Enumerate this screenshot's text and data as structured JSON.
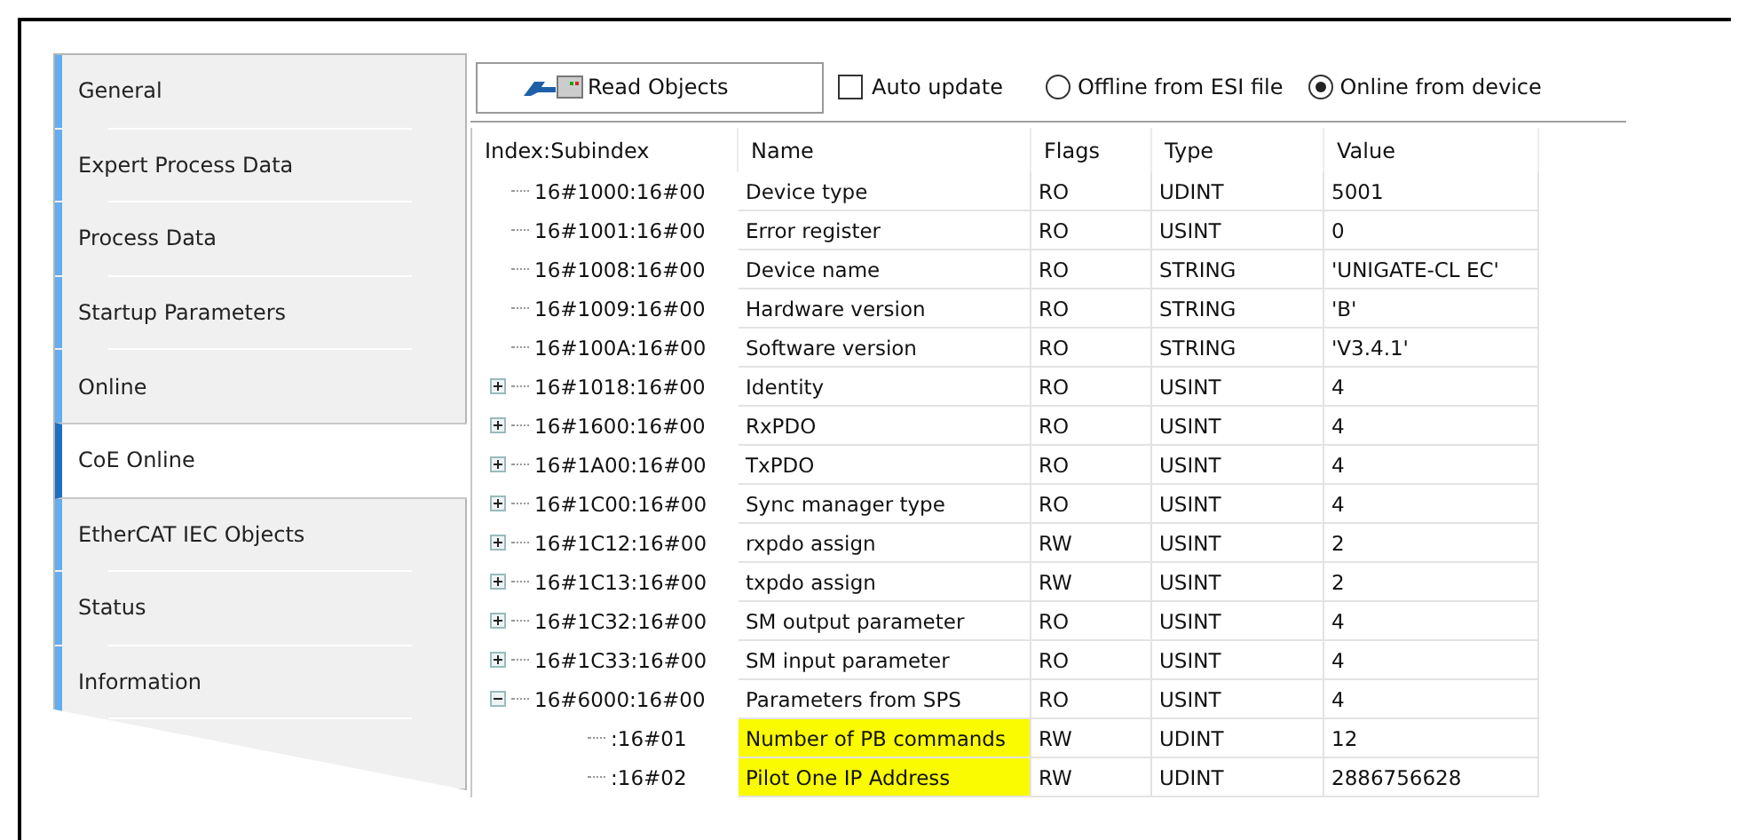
{
  "sidebar": {
    "tabs": [
      {
        "label": "General",
        "selected": false
      },
      {
        "label": "Expert Process Data",
        "selected": false
      },
      {
        "label": "Process Data",
        "selected": false
      },
      {
        "label": "Startup Parameters",
        "selected": false
      },
      {
        "label": "Online",
        "selected": false
      },
      {
        "label": "CoE Online",
        "selected": true
      },
      {
        "label": "EtherCAT IEC Objects",
        "selected": false
      },
      {
        "label": "Status",
        "selected": false
      },
      {
        "label": "Information",
        "selected": false
      }
    ]
  },
  "toolbar": {
    "read_button": "Read Objects",
    "auto_update": {
      "label": "Auto update",
      "checked": false
    },
    "source": [
      {
        "label": "Offline from ESI file",
        "selected": false
      },
      {
        "label": "Online from device",
        "selected": true
      }
    ]
  },
  "table": {
    "columns": [
      "Index:Subindex",
      "Name",
      "Flags",
      "Type",
      "Value"
    ],
    "rows": [
      {
        "index": "16#1000:16#00",
        "name": "Device type",
        "flags": "RO",
        "type": "UDINT",
        "value": "5001",
        "highlighted": false
      },
      {
        "index": "16#1001:16#00",
        "name": "Error register",
        "flags": "RO",
        "type": "USINT",
        "value": "0",
        "highlighted": false
      },
      {
        "index": "16#1008:16#00",
        "name": "Device name",
        "flags": "RO",
        "type": "STRING",
        "value": "'UNIGATE-CL EC'",
        "highlighted": false
      },
      {
        "index": "16#1009:16#00",
        "name": "Hardware version",
        "flags": "RO",
        "type": "STRING",
        "value": "'B'",
        "highlighted": false
      },
      {
        "index": "16#100A:16#00",
        "name": "Software version",
        "flags": "RO",
        "type": "STRING",
        "value": "'V3.4.1'",
        "highlighted": false
      },
      {
        "index": "16#1018:16#00",
        "name": "Identity",
        "flags": "RO",
        "type": "USINT",
        "value": "4",
        "highlighted": false,
        "expanded": false
      },
      {
        "index": "16#1600:16#00",
        "name": "RxPDO",
        "flags": "RO",
        "type": "USINT",
        "value": "4",
        "highlighted": false,
        "expanded": false
      },
      {
        "index": "16#1A00:16#00",
        "name": "TxPDO",
        "flags": "RO",
        "type": "USINT",
        "value": "4",
        "highlighted": false,
        "expanded": false
      },
      {
        "index": "16#1C00:16#00",
        "name": "Sync manager type",
        "flags": "RO",
        "type": "USINT",
        "value": "4",
        "highlighted": false,
        "expanded": false
      },
      {
        "index": "16#1C12:16#00",
        "name": "rxpdo assign",
        "flags": "RW",
        "type": "USINT",
        "value": "2",
        "highlighted": false,
        "expanded": false
      },
      {
        "index": "16#1C13:16#00",
        "name": "txpdo assign",
        "flags": "RW",
        "type": "USINT",
        "value": "2",
        "highlighted": false,
        "expanded": false
      },
      {
        "index": "16#1C32:16#00",
        "name": "SM output parameter",
        "flags": "RO",
        "type": "USINT",
        "value": "4",
        "highlighted": false,
        "expanded": false
      },
      {
        "index": "16#1C33:16#00",
        "name": "SM input parameter",
        "flags": "RO",
        "type": "USINT",
        "value": "4",
        "highlighted": false,
        "expanded": false
      },
      {
        "index": "16#6000:16#00",
        "name": "Parameters from SPS",
        "flags": "RO",
        "type": "USINT",
        "value": "4",
        "highlighted": false,
        "expanded": true,
        "children": [
          {
            "index": ":16#01",
            "name": "Number of PB commands",
            "flags": "RW",
            "type": "UDINT",
            "value": "12",
            "highlighted": true
          },
          {
            "index": ":16#02",
            "name": "Pilot One IP Address",
            "flags": "RW",
            "type": "UDINT",
            "value": "2886756628",
            "highlighted": true
          }
        ]
      }
    ]
  }
}
